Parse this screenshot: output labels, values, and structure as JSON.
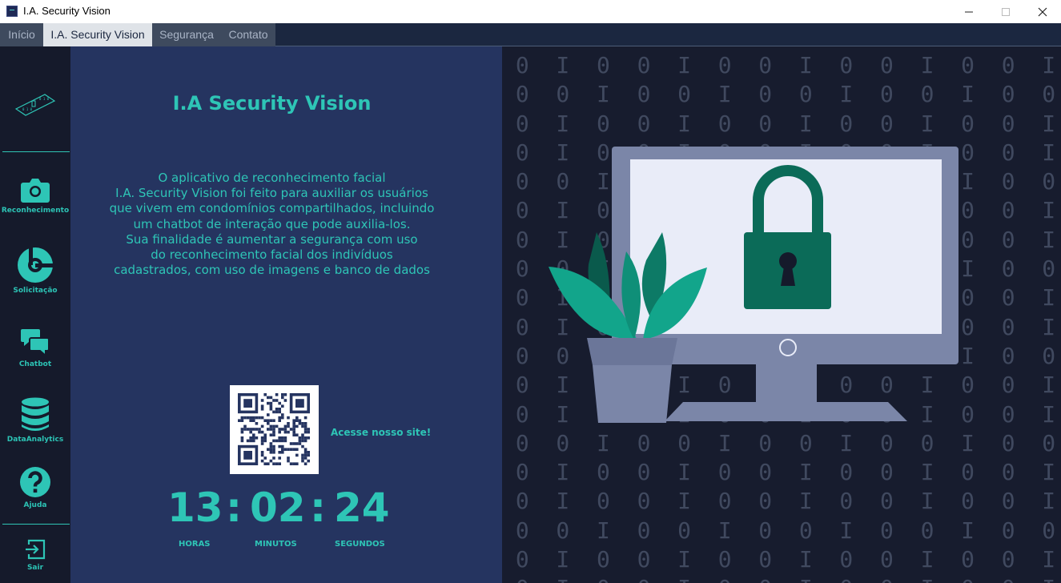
{
  "window": {
    "title": "I.A. Security Vision"
  },
  "tabs": [
    {
      "label": "Início",
      "active": false
    },
    {
      "label": "I.A. Security Vision",
      "active": true
    },
    {
      "label": "Segurança",
      "active": false
    },
    {
      "label": "Contato",
      "active": false
    }
  ],
  "sidebar": {
    "items": [
      {
        "label": "Reconhecimento",
        "icon": "camera-icon"
      },
      {
        "label": "Solicitação",
        "icon": "request-icon"
      },
      {
        "label": "Chatbot",
        "icon": "chat-icon"
      },
      {
        "label": "DataAnalytics",
        "icon": "database-icon"
      },
      {
        "label": "Ajuda",
        "icon": "help-icon"
      },
      {
        "label": "Sair",
        "icon": "exit-icon"
      }
    ]
  },
  "main": {
    "title": "I.A Security Vision",
    "description_lines": [
      "O aplicativo de reconhecimento facial",
      "I.A. Security Vision foi feito para auxiliar os usuários",
      "que vivem em condomínios compartilhados, incluindo",
      "um chatbot de interação que pode auxilia-los.",
      "Sua finalidade é aumentar a segurança com uso",
      "do reconhecimento facial dos indivíduos",
      "cadastrados, com uso de imagens e banco de dados"
    ],
    "qr_label": "Acesse nosso site!"
  },
  "clock": {
    "hours": "13",
    "minutes": "02",
    "seconds": "24",
    "separator": ":",
    "hours_label": "HORAS",
    "minutes_label": "MINUTOS",
    "seconds_label": "SEGUNDOS"
  },
  "colors": {
    "accent": "#2ec5b6",
    "panel": "#253460",
    "sidebar": "#151a2b",
    "background": "#171c2e"
  }
}
